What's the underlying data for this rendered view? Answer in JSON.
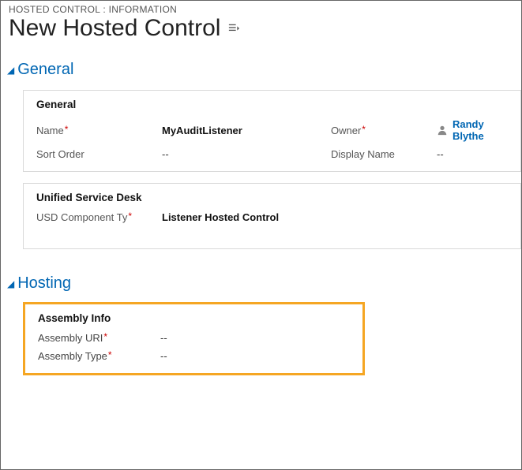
{
  "breadcrumb": "HOSTED CONTROL : INFORMATION",
  "page_title": "New Hosted Control",
  "sections": {
    "general": {
      "label": "General",
      "panel1_title": "General",
      "fields": {
        "name_label": "Name",
        "name_value": "MyAuditListener",
        "owner_label": "Owner",
        "owner_value": "Randy Blythe",
        "sort_order_label": "Sort Order",
        "sort_order_value": "--",
        "display_name_label": "Display Name",
        "display_name_value": "--"
      },
      "panel2_title": "Unified Service Desk",
      "usd_type_label": "USD Component Ty",
      "usd_type_value": "Listener Hosted Control"
    },
    "hosting": {
      "label": "Hosting",
      "panel_title": "Assembly Info",
      "assembly_uri_label": "Assembly URI",
      "assembly_uri_value": "--",
      "assembly_type_label": "Assembly Type",
      "assembly_type_value": "--"
    }
  }
}
